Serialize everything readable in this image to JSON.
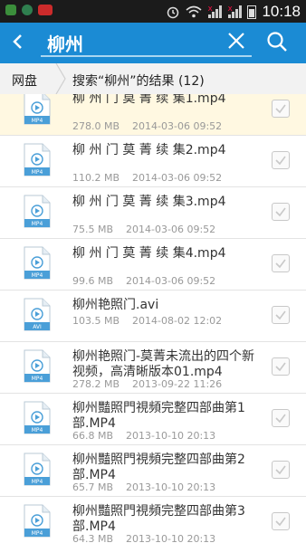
{
  "status_bar": {
    "time": "10:18"
  },
  "search": {
    "query": "柳州"
  },
  "breadcrumb": {
    "root": "网盘",
    "current": "搜索“柳州”的结果 (12)"
  },
  "files": [
    {
      "name": "柳 州 门 莫 菁 续 集1.mp4",
      "size": "278.0 MB",
      "date": "2014-03-06 09:52",
      "type": "MP4",
      "selected": true
    },
    {
      "name": "柳 州 门 莫 菁 续 集2.mp4",
      "size": "110.2 MB",
      "date": "2014-03-06 09:52",
      "type": "MP4",
      "selected": false
    },
    {
      "name": "柳 州 门 莫 菁 续 集3.mp4",
      "size": "75.5 MB",
      "date": "2014-03-06 09:52",
      "type": "MP4",
      "selected": false
    },
    {
      "name": "柳 州 门 莫 菁 续 集4.mp4",
      "size": "99.6 MB",
      "date": "2014-03-06 09:52",
      "type": "MP4",
      "selected": false
    },
    {
      "name": "柳州艳照门.avi",
      "size": "103.5 MB",
      "date": "2014-08-02 12:02",
      "type": "AVI",
      "selected": false
    },
    {
      "name": "柳州艳照门-莫菁未流出的四个新视频，高清晰版本01.mp4",
      "size": "278.2 MB",
      "date": "2013-09-22 11:26",
      "type": "MP4",
      "selected": false
    },
    {
      "name": "柳州豔照門視頻完整四部曲第1部.MP4",
      "size": "66.8 MB",
      "date": "2013-10-10 20:13",
      "type": "MP4",
      "selected": false
    },
    {
      "name": "柳州豔照門視頻完整四部曲第2部.MP4",
      "size": "65.7 MB",
      "date": "2013-10-10 20:13",
      "type": "MP4",
      "selected": false
    },
    {
      "name": "柳州豔照門視頻完整四部曲第3部.MP4",
      "size": "64.3 MB",
      "date": "2013-10-10 20:13",
      "type": "MP4",
      "selected": false
    }
  ],
  "colors": {
    "header": "#1b8bd4",
    "status_bar": "#1b1b1b",
    "selected_row": "#fff8e1",
    "file_icon": "#4a9fd8"
  }
}
